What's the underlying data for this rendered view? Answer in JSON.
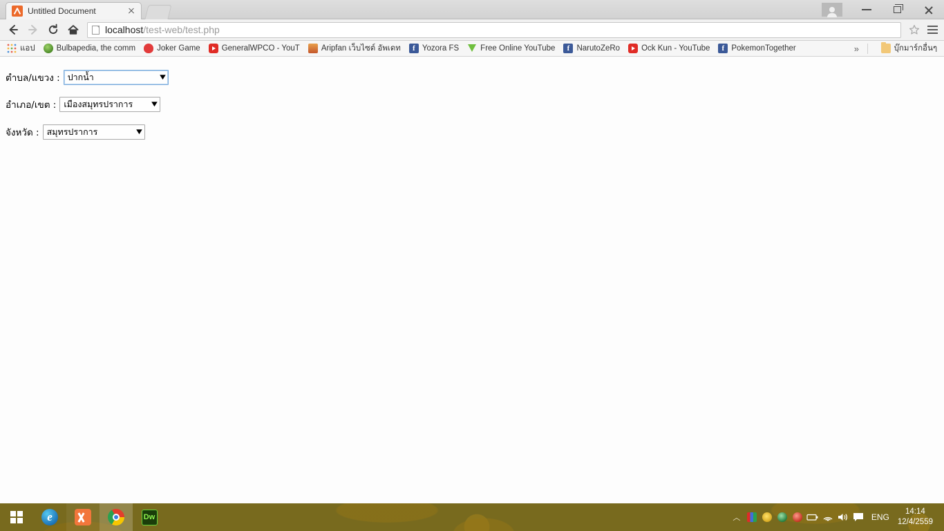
{
  "window": {
    "tab_title": "Untitled Document",
    "favicon": "xampp-icon",
    "close_tab": "close-tab-icon",
    "new_tab": "new-tab-button",
    "profile": "profile-avatar-icon",
    "minimize": "minimize-icon",
    "maximize": "maximize-icon",
    "close": "close-window-icon"
  },
  "toolbar": {
    "back": "back-arrow-icon",
    "forward": "forward-arrow-icon",
    "reload": "reload-icon",
    "home": "home-icon",
    "page_icon": "page-document-icon",
    "url_host": "localhost",
    "url_path": "/test-web/test.php",
    "url_full": "localhost/test-web/test.php",
    "star": "★",
    "menu": "hamburger-menu-icon"
  },
  "bookmarks": {
    "items": [
      {
        "label": "แอป",
        "icon": "apps-grid-icon"
      },
      {
        "label": "Bulbapedia, the comm",
        "icon": "bulbapedia-icon"
      },
      {
        "label": "Joker Game",
        "icon": "joker-game-icon"
      },
      {
        "label": "GeneralWPCO - YouT",
        "icon": "youtube-icon"
      },
      {
        "label": "Aripfan เว็บไซต์ อัพเดท",
        "icon": "aripfan-icon"
      },
      {
        "label": "Yozora FS",
        "icon": "facebook-icon"
      },
      {
        "label": "Free Online YouTube",
        "icon": "download-icon"
      },
      {
        "label": "NarutoZeRo",
        "icon": "facebook-icon"
      },
      {
        "label": "Ock Kun - YouTube",
        "icon": "youtube-icon"
      },
      {
        "label": "PokemonTogether",
        "icon": "facebook-icon"
      }
    ],
    "overflow": "»",
    "other_bookmarks": "บุ๊กมาร์กอื่นๆ",
    "other_bookmarks_icon": "folder-icon"
  },
  "page": {
    "rows": [
      {
        "label": "ตำบล/แขวง :",
        "value": "ปากน้ำ",
        "caret": "▼",
        "focused": true
      },
      {
        "label": "อำเภอ/เขต :",
        "value": "เมืองสมุทรปราการ",
        "caret": "▼",
        "focused": false
      },
      {
        "label": "จังหวัด :",
        "value": "สมุทรปราการ",
        "caret": "▼",
        "focused": false
      }
    ]
  },
  "taskbar": {
    "apps": [
      {
        "name": "start-button",
        "label": ""
      },
      {
        "name": "edge-taskbar-icon",
        "label": ""
      },
      {
        "name": "xampp-taskbar-icon",
        "label": ""
      },
      {
        "name": "chrome-taskbar-icon",
        "label": ""
      },
      {
        "name": "dreamweaver-taskbar-icon",
        "label": "Dw"
      }
    ],
    "tray": {
      "chevron": "︿",
      "language": "ENG",
      "time": "14:14",
      "date": "12/4/2559"
    }
  },
  "colors": {
    "taskbar": "#786a1e",
    "accent_focus": "#7aabdc",
    "page_bg": "#fdfdfd",
    "chrome_bg": "#f1f1f1"
  }
}
